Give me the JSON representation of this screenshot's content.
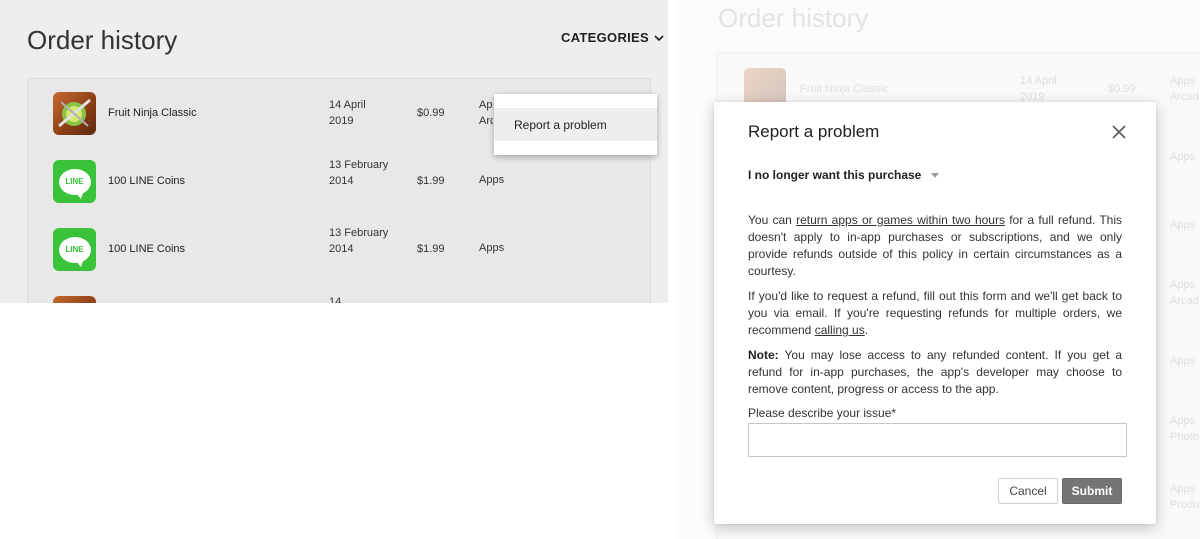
{
  "left": {
    "title": "Order history",
    "categories_label": "CATEGORIES",
    "orders": [
      {
        "name": "Fruit Ninja Classic",
        "date": "14 April 2019",
        "price": "$0.99",
        "category": "Apps Arc",
        "icon": "fruit-ninja-icon"
      },
      {
        "name": "100 LINE Coins",
        "date": "13 February 2014",
        "price": "$1.99",
        "category": "Apps",
        "icon": "line-icon"
      },
      {
        "name": "100 LINE Coins",
        "date": "13 February 2014",
        "price": "$1.99",
        "category": "Apps",
        "icon": "line-icon"
      },
      {
        "name": "",
        "date": "14",
        "price": "",
        "category": "",
        "icon": "app-icon"
      }
    ],
    "line_icon_text": "LINE",
    "menu": {
      "report_label": "Report a problem"
    }
  },
  "right_bg": {
    "title": "Order history",
    "row1": {
      "name": "Fruit Ninja Classic",
      "date": "14 April 2019",
      "price": "$0.99",
      "category": "Apps Arcad"
    },
    "categories": [
      "Apps",
      "Apps",
      "Apps Arcad",
      "Apps",
      "Apps Photo",
      "Apps Produ"
    ]
  },
  "modal": {
    "title": "Report a problem",
    "reason": "I no longer want this purchase",
    "p1_before": "You can ",
    "p1_link": "return apps or games within two hours",
    "p1_after": " for a full refund. This doesn't apply to in-app purchases or subscriptions, and we only provide refunds outside of this policy in certain circumstances as a courtesy.",
    "p2_before": "If you'd like to request a refund, fill out this form and we'll get back to you via email. If you're requesting refunds for multiple orders, we recommend ",
    "p2_link": "calling us",
    "p2_after": ".",
    "p3_bold": "Note:",
    "p3_rest": " You may lose access to any refunded content. If you get a refund for in-app purchases, the app's developer may choose to remove content, progress or access to the app.",
    "field_label": "Please describe your issue*",
    "input_value": "",
    "cancel_label": "Cancel",
    "submit_label": "Submit"
  },
  "colors": {
    "page_bg_left": "#eeeeee",
    "line_green": "#3ac23a",
    "submit_bg": "#757575"
  }
}
